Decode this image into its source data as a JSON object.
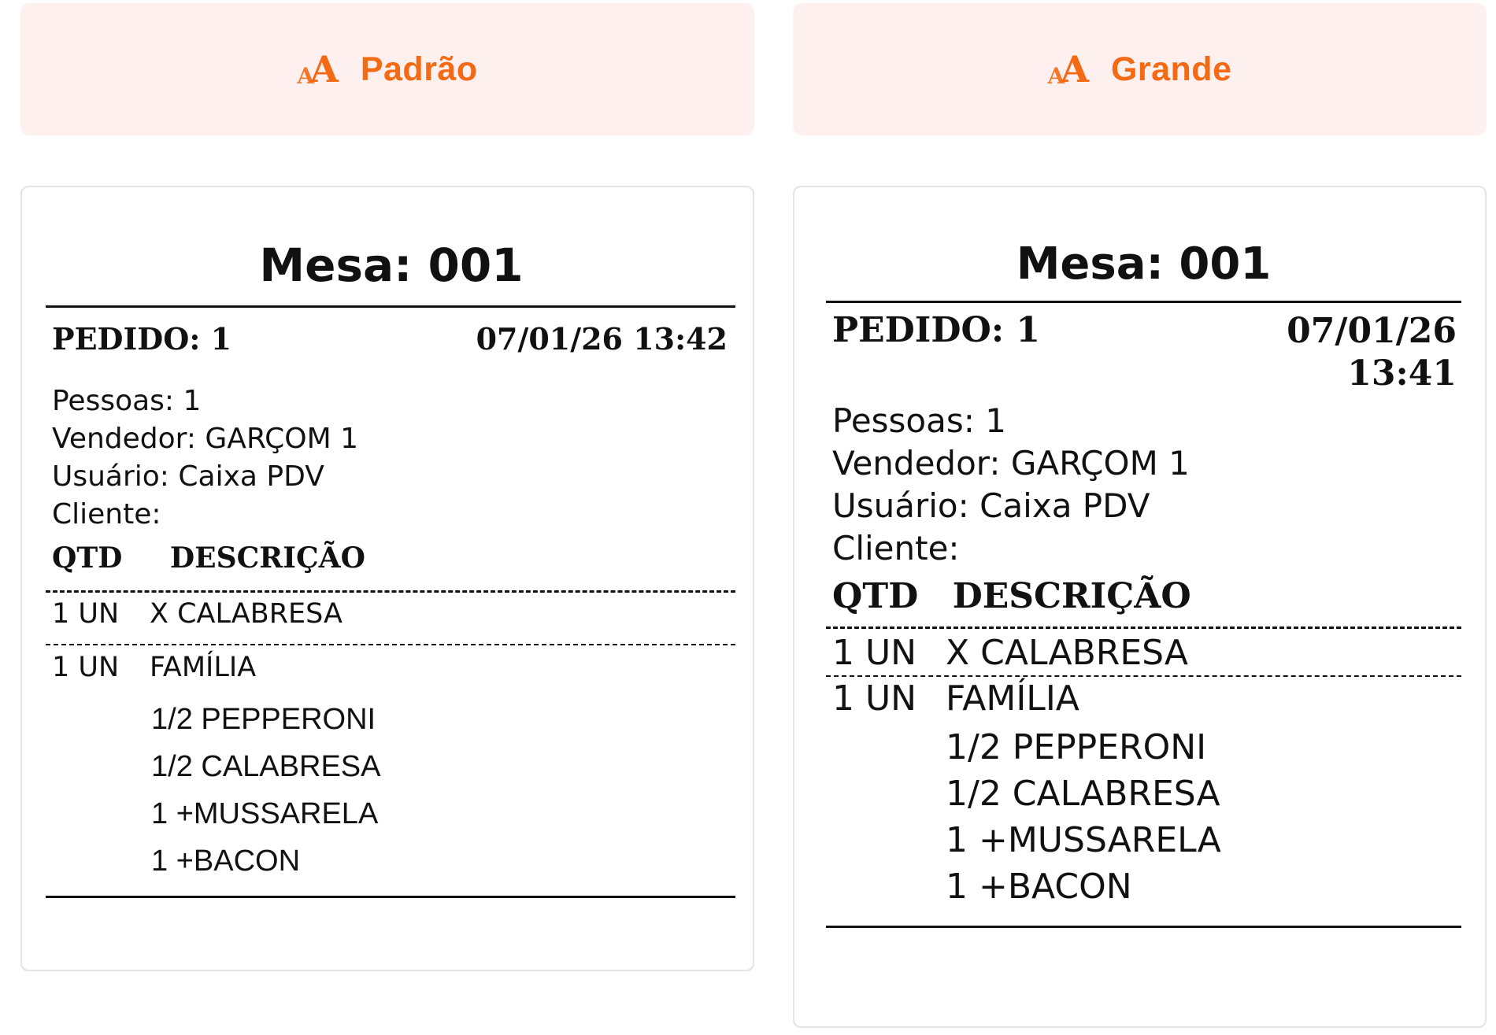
{
  "options": [
    {
      "label": "Padrão",
      "icon": "font-size-icon"
    },
    {
      "label": "Grande",
      "icon": "font-size-icon"
    }
  ],
  "colors": {
    "accent": "#f46a14",
    "button_bg": "#fef0ef",
    "ink": "#111111"
  },
  "receipts": [
    {
      "title": "Mesa: 001",
      "pedido": "PEDIDO: 1",
      "datetime": "07/01/26 13:42",
      "pessoas": "Pessoas: 1",
      "vendedor": "Vendedor: GARÇOM 1",
      "usuario": "Usuário: Caixa PDV",
      "cliente": "Cliente:",
      "col_qtd": "QTD",
      "col_desc": "DESCRIÇÃO",
      "items": [
        {
          "qty": "1 UN",
          "desc": "X CALABRESA"
        },
        {
          "qty": "1 UN",
          "desc": "FAMÍLIA"
        }
      ],
      "subitems": [
        "1/2 PEPPERONI",
        "1/2 CALABRESA",
        "1 +MUSSARELA",
        "1 +BACON"
      ]
    },
    {
      "title": "Mesa: 001",
      "pedido": "PEDIDO: 1",
      "date": "07/01/26",
      "time": "13:41",
      "pessoas": "Pessoas: 1",
      "vendedor": "Vendedor: GARÇOM 1",
      "usuario": "Usuário: Caixa PDV",
      "cliente": "Cliente:",
      "col_qtd": "QTD",
      "col_desc": "DESCRIÇÃO",
      "items": [
        {
          "qty": "1 UN",
          "desc": "X CALABRESA"
        },
        {
          "qty": "1 UN",
          "desc": "FAMÍLIA"
        }
      ],
      "subitems": [
        "1/2 PEPPERONI",
        "1/2 CALABRESA",
        "1 +MUSSARELA",
        "1 +BACON"
      ]
    }
  ]
}
